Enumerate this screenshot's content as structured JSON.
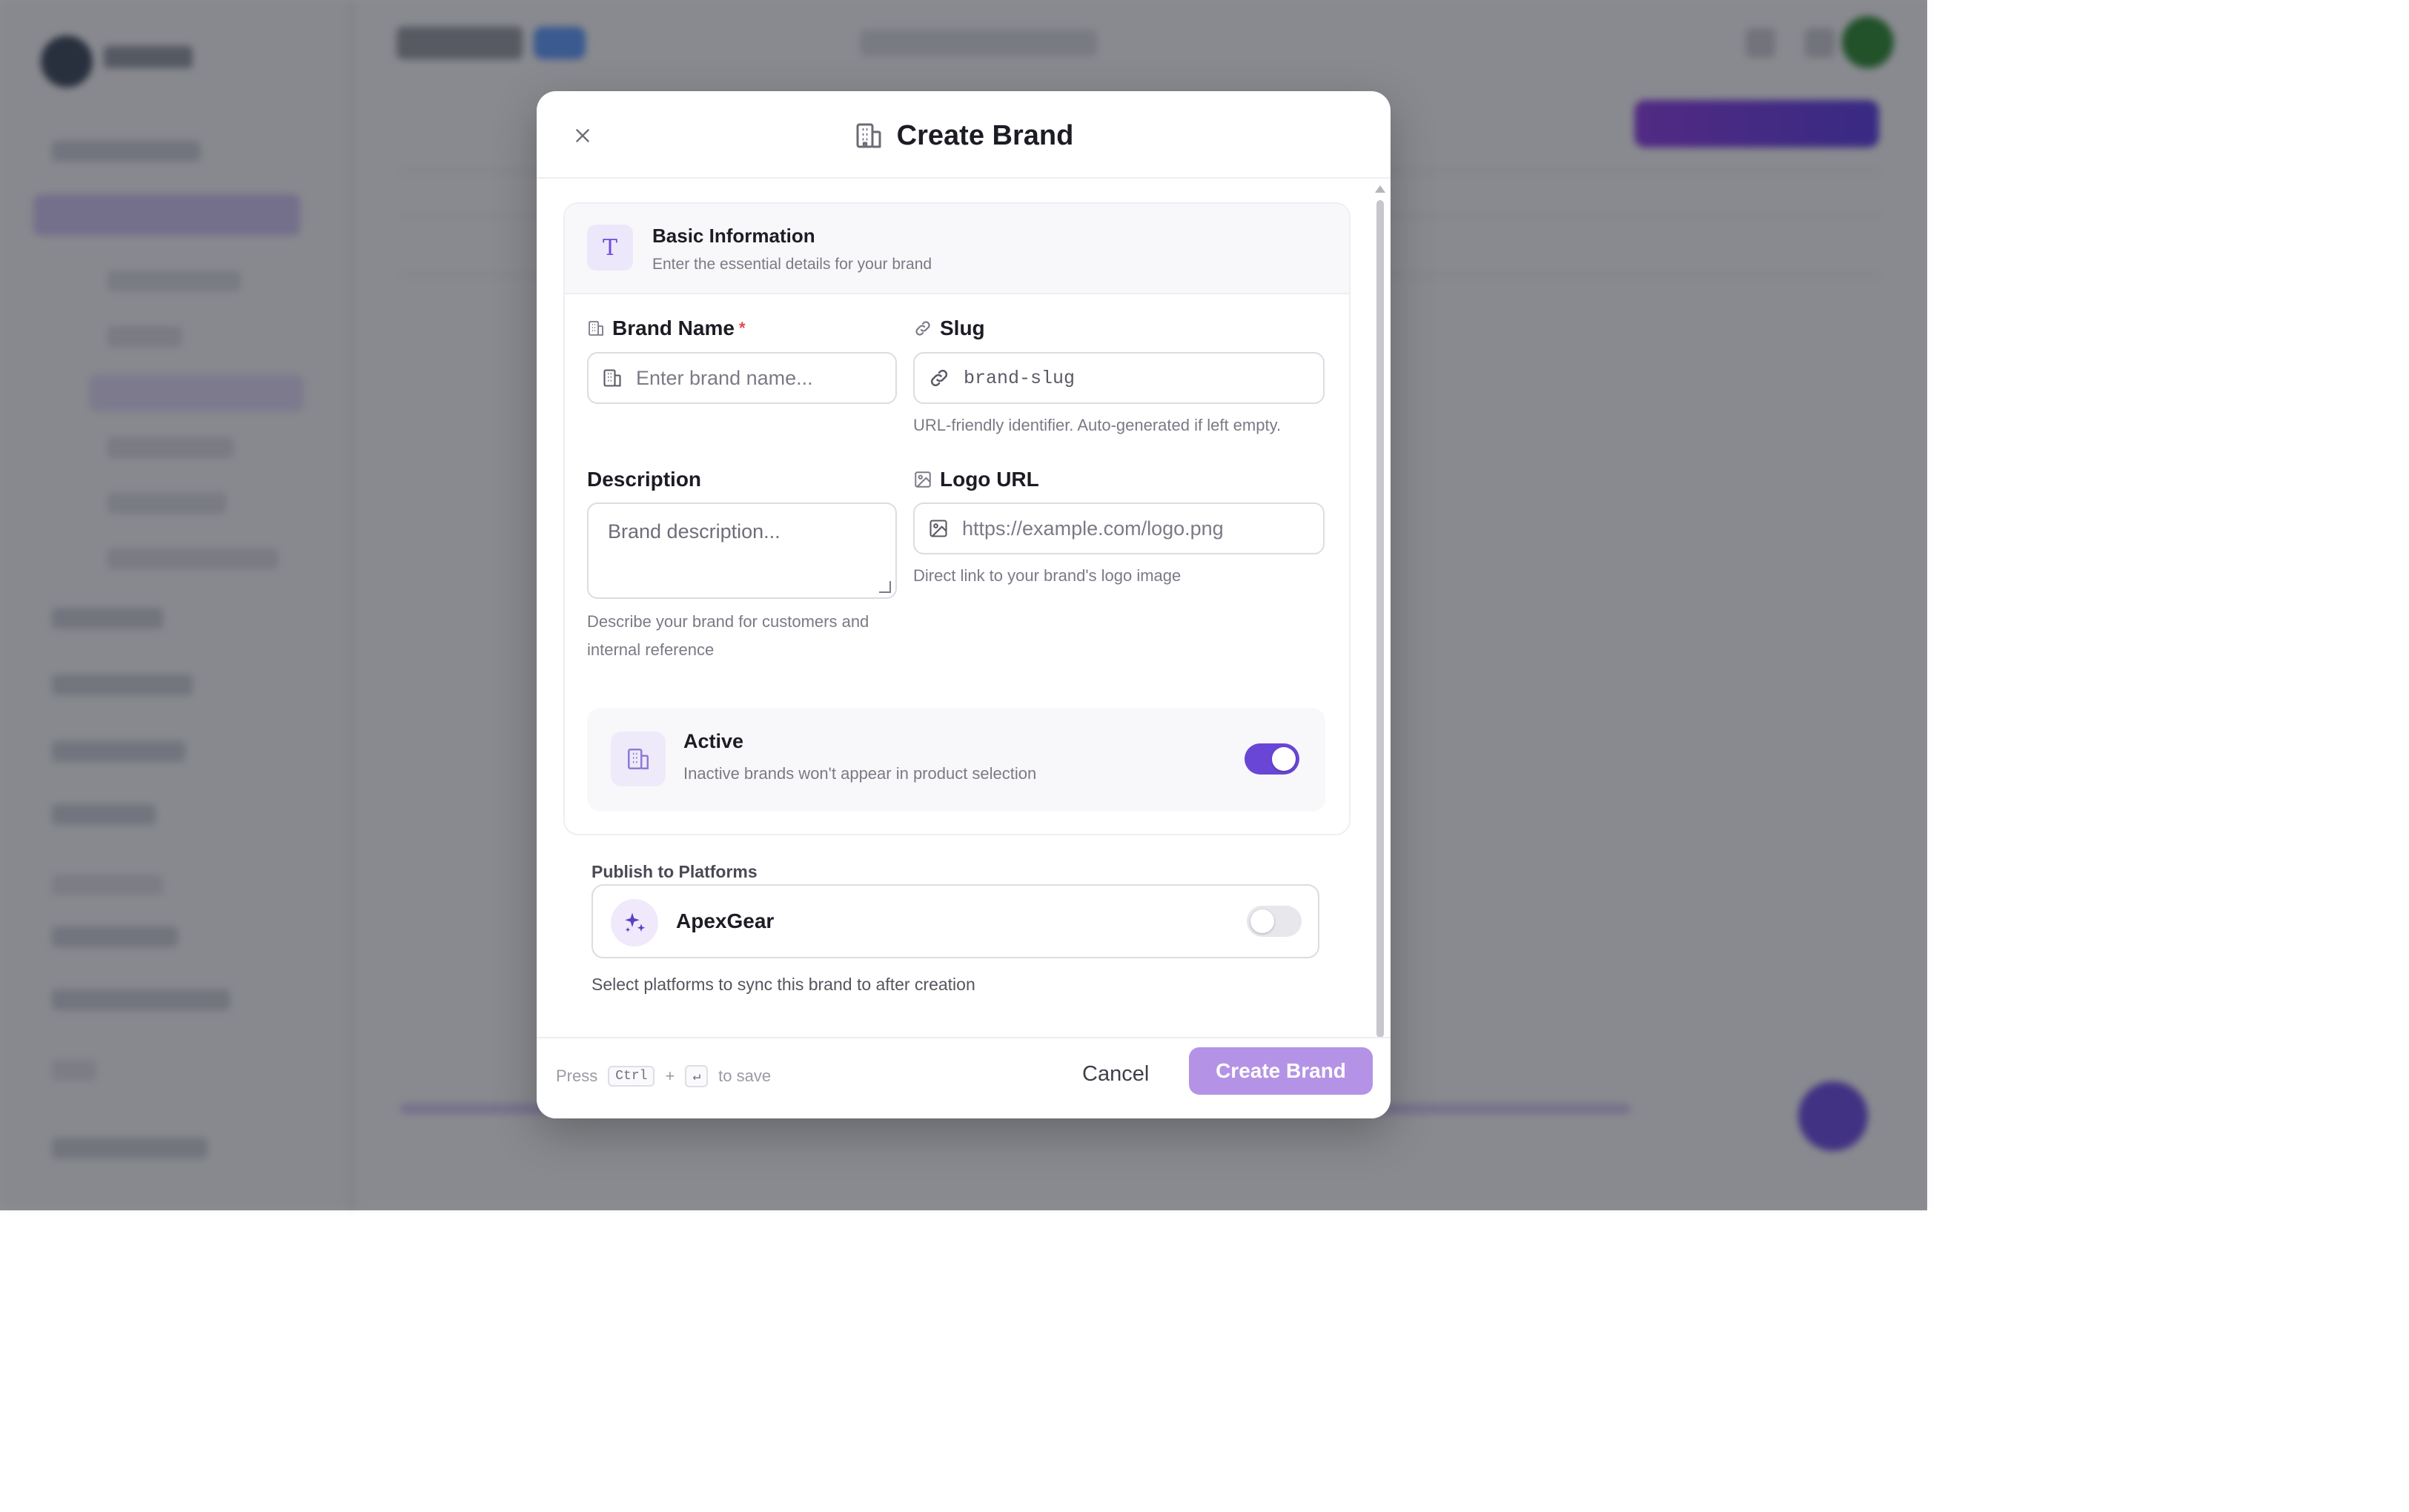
{
  "modal": {
    "title": "Create Brand",
    "icons": {
      "close": "close-icon",
      "title": "building-icon"
    }
  },
  "basic_info": {
    "title": "Basic Information",
    "subtitle": "Enter the essential details for your brand",
    "icon": "type-icon",
    "icon_glyph": "T"
  },
  "fields": {
    "brand_name": {
      "label": "Brand Name",
      "required_mark": "*",
      "placeholder": "Enter brand name...",
      "value": ""
    },
    "slug": {
      "label": "Slug",
      "placeholder": "brand-slug",
      "value": "",
      "hint": "URL-friendly identifier. Auto-generated if left empty."
    },
    "description": {
      "label": "Description",
      "placeholder": "Brand description...",
      "value": "",
      "hint": "Describe your brand for customers and internal reference"
    },
    "logo_url": {
      "label": "Logo URL",
      "placeholder": "https://example.com/logo.png",
      "value": "",
      "hint": "Direct link to your brand's logo image"
    }
  },
  "active": {
    "title": "Active",
    "subtitle": "Inactive brands won't appear in product selection",
    "enabled": true
  },
  "publish": {
    "label": "Publish to Platforms",
    "platforms": [
      {
        "name": "ApexGear",
        "enabled": false
      }
    ],
    "hint": "Select platforms to sync this brand to after creation"
  },
  "footer": {
    "press": "Press",
    "key_ctrl": "Ctrl",
    "plus": "+",
    "key_enter": "↵",
    "to_save": "to save",
    "cancel_label": "Cancel",
    "create_label": "Create Brand"
  },
  "colors": {
    "accent": "#6a46d6",
    "create_button": "#b493e6",
    "required": "#e24a4a"
  }
}
